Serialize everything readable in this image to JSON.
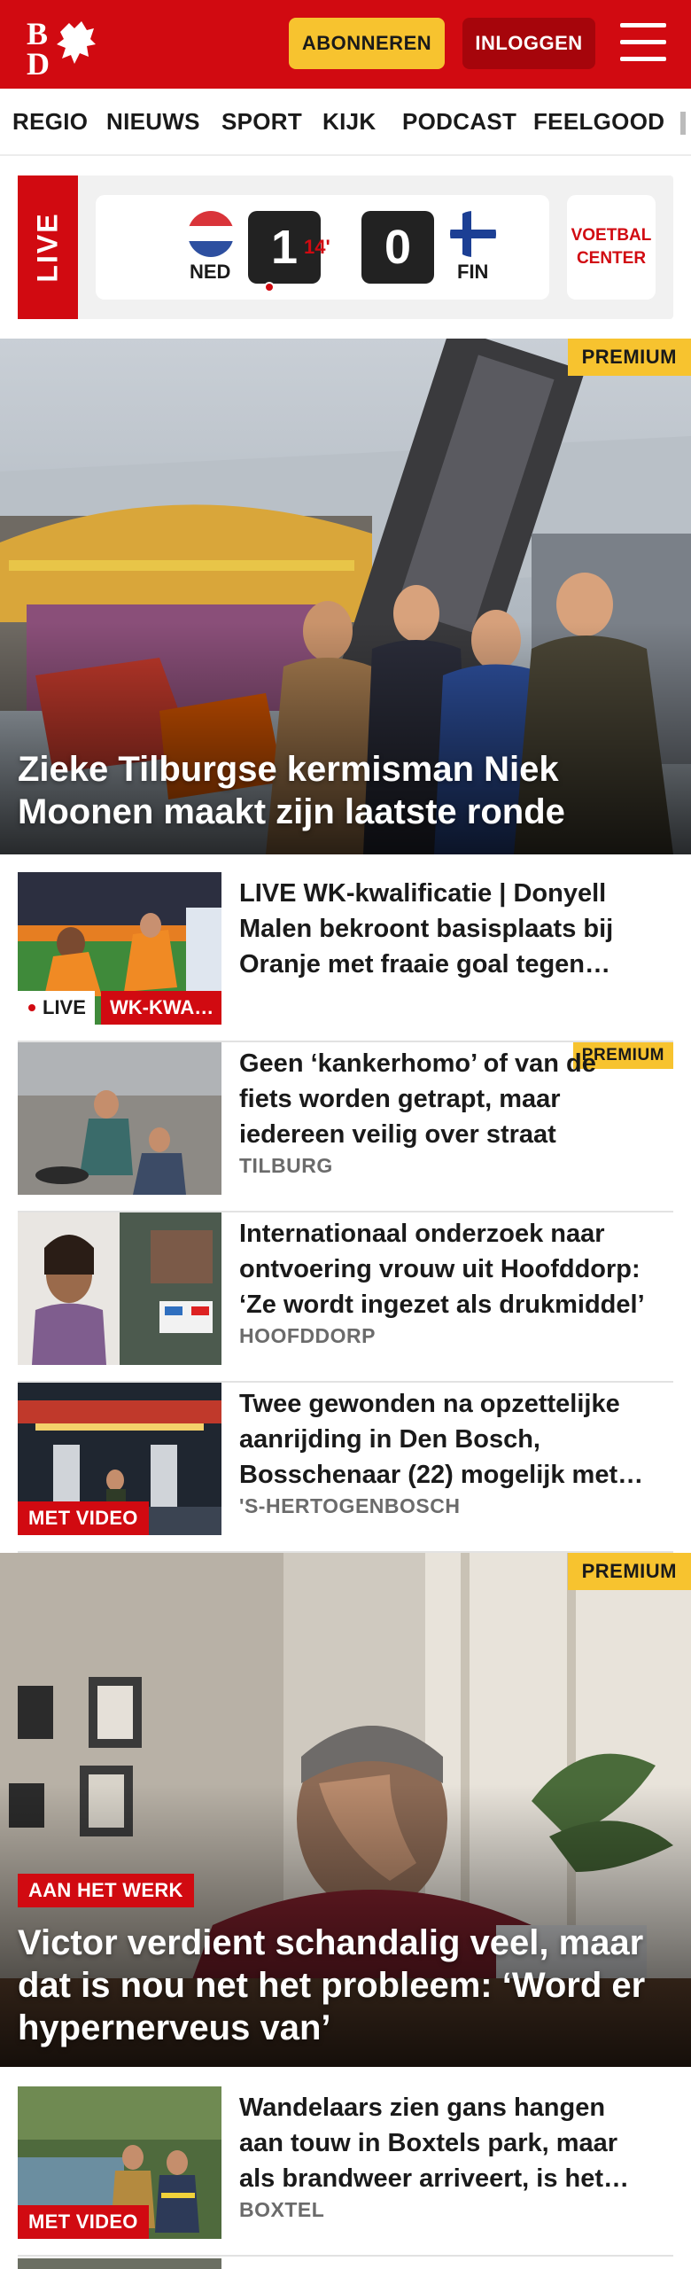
{
  "header": {
    "logo_text": "BD",
    "subscribe_label": "ABONNEREN",
    "login_label": "INLOGGEN",
    "brand_color": "#d10a11"
  },
  "nav": {
    "items": [
      "REGIO",
      "NIEUWS",
      "SPORT",
      "KIJK",
      "PODCAST",
      "FEELGOOD"
    ]
  },
  "live_score": {
    "live_label": "LIVE",
    "home_code": "NED",
    "home_score": "1",
    "minute": "14'",
    "away_score": "0",
    "away_code": "FIN",
    "center_label_line1": "VOETBAL",
    "center_label_line2": "CENTER"
  },
  "hero1": {
    "premium_label": "PREMIUM",
    "title_line1": "Zieke Tilburgse kermisman Niek",
    "title_line2": "Moonen maakt zijn laatste ronde"
  },
  "articles": [
    {
      "title": "LIVE WK-kwalificatie | Donyell Malen bekroont basisplaats bij Oranje met fraaie goal tegen…",
      "live_label": "LIVE",
      "category_label": "WK-KWA…"
    },
    {
      "title": "Geen ‘kankerhomo’ of van de fiets worden getrapt, maar iedereen veilig over straat",
      "location": "TILBURG",
      "premium_label": "PREMIUM"
    },
    {
      "title": "Internationaal onderzoek naar ontvoering vrouw uit Hoofddorp: ‘Ze wordt ingezet als drukmiddel’",
      "location": "HOOFDDORP"
    },
    {
      "title": "Twee gewonden na opzettelijke aanrijding in Den Bosch, Bosschenaar (22) mogelijk met…",
      "location": "'S-HERTOGENBOSCH",
      "video_label": "MET VIDEO"
    }
  ],
  "hero2": {
    "premium_label": "PREMIUM",
    "category_label": "AAN HET WERK",
    "title_line1": "Victor verdient schandalig veel, maar",
    "title_line2": "dat is nou net het probleem: ‘Word er",
    "title_line3": "hypernerveus van’"
  },
  "article5": {
    "title": "Wandelaars zien gans hangen aan touw in Boxtels park, maar als brandweer arriveert, is het…",
    "location": "BOXTEL",
    "video_label": "MET VIDEO"
  },
  "colors": {
    "red": "#d10a11",
    "dark_red": "#a6050b",
    "yellow": "#f7c32f",
    "text": "#1a1a1a",
    "muted": "#6b6b6b"
  }
}
